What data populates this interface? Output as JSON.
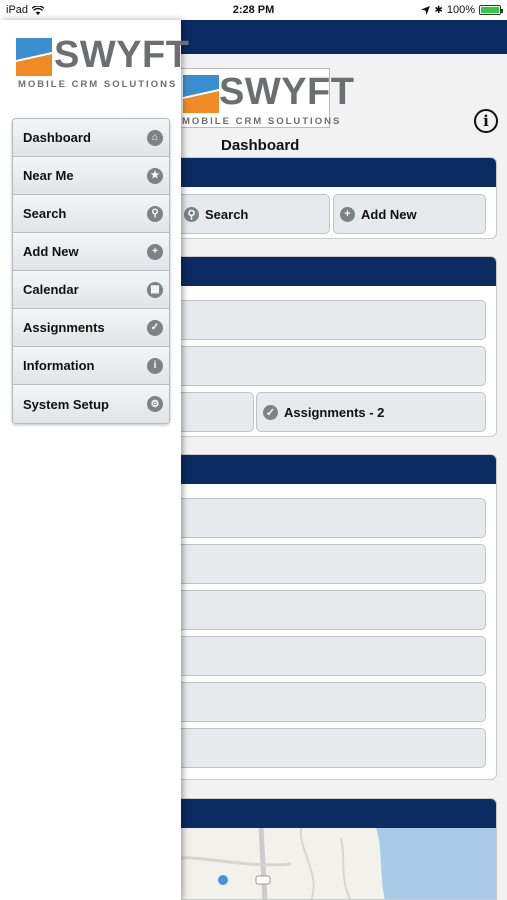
{
  "status_bar": {
    "device": "iPad",
    "time": "2:28 PM",
    "battery": "100%",
    "battery_level": 1.0
  },
  "brand": {
    "name": "SWYFT",
    "tagline": "MOBILE CRM SOLUTIONS",
    "colors": {
      "navy": "#0b2b63",
      "orange": "#f08a24",
      "blue": "#3a8fd1",
      "gray": "#6d6e71"
    }
  },
  "drawer": {
    "menu": [
      {
        "label": "Dashboard",
        "icon": "home-icon"
      },
      {
        "label": "Near Me",
        "icon": "star-icon"
      },
      {
        "label": "Search",
        "icon": "search-icon"
      },
      {
        "label": "Add New",
        "icon": "plus-icon"
      },
      {
        "label": "Calendar",
        "icon": "calendar-icon"
      },
      {
        "label": "Assignments",
        "icon": "check-icon"
      },
      {
        "label": "Information",
        "icon": "info-icon"
      },
      {
        "label": "System Setup",
        "icon": "gear-icon"
      }
    ]
  },
  "main": {
    "title": "Dashboard",
    "quick_actions": {
      "search": "Search",
      "add_new": "Add New"
    },
    "assignments_button": "Assignments - 2"
  }
}
